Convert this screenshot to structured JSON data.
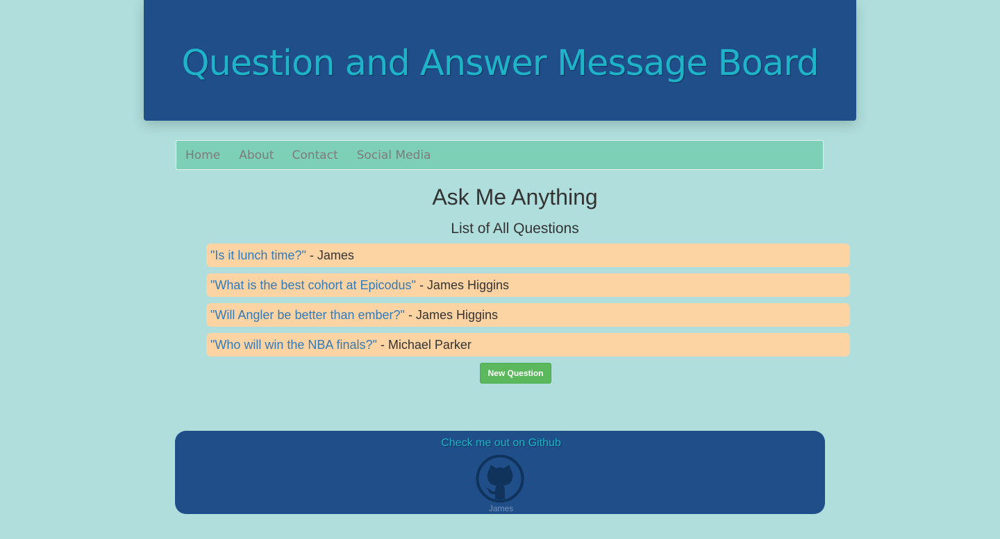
{
  "header": {
    "title": "Question and Answer Message Board"
  },
  "nav": {
    "items": [
      {
        "label": "Home"
      },
      {
        "label": "About"
      },
      {
        "label": "Contact"
      },
      {
        "label": "Social Media"
      }
    ]
  },
  "main": {
    "title": "Ask Me Anything",
    "subtitle": "List of All Questions",
    "questions": [
      {
        "text": "\"Is it lunch time?\"",
        "author": " - James"
      },
      {
        "text": "\"What is the best cohort at Epicodus\"",
        "author": " - James Higgins"
      },
      {
        "text": "\"Will Angler be better than ember?\"",
        "author": " - James Higgins"
      },
      {
        "text": "\"Who will win the NBA finals?\"",
        "author": " - Michael Parker"
      }
    ],
    "new_question_label": "New Question"
  },
  "footer": {
    "github_link": "Check me out on Github",
    "icon": "github-octocat-icon",
    "caption": "James"
  },
  "colors": {
    "background": "#b0dedc",
    "header_bg": "#1f4e89",
    "title_text": "#1eb3c9",
    "nav_bg": "#7dd0b6",
    "question_bg": "#fcd3a3",
    "link": "#337ab7",
    "button": "#5cb85c"
  }
}
